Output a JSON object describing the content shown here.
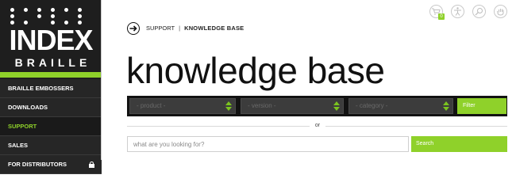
{
  "logo": {
    "index": "INDEX",
    "braille": "BRAILLE",
    "dots": [
      1,
      1,
      1,
      1,
      1,
      1,
      1,
      0,
      1,
      1,
      0,
      1,
      1,
      1,
      0,
      1,
      1,
      1
    ]
  },
  "nav": {
    "items": [
      {
        "label": "BRAILLE EMBOSSERS"
      },
      {
        "label": "DOWNLOADS"
      },
      {
        "label": "SUPPORT"
      },
      {
        "label": "SALES"
      },
      {
        "label": "FOR DISTRIBUTORS"
      }
    ],
    "active_index": 2
  },
  "top_icons": {
    "cart_count": "0",
    "icons": [
      "cart-icon",
      "accessibility-icon",
      "search-icon",
      "hand-icon"
    ]
  },
  "breadcrumb": {
    "parent": "SUPPORT",
    "separator": "|",
    "current": "KNOWLEDGE BASE"
  },
  "page": {
    "title": "knowledge base"
  },
  "filters": {
    "product": "- product -",
    "version": "- version -",
    "category": "- category -",
    "filter_label": "Filter"
  },
  "or_label": "or",
  "search": {
    "placeholder": "what are you looking for?",
    "button_label": "Search"
  },
  "colors": {
    "accent": "#8fd12a",
    "sidebar": "#1e1e1e",
    "filter_bar": "#121212"
  }
}
